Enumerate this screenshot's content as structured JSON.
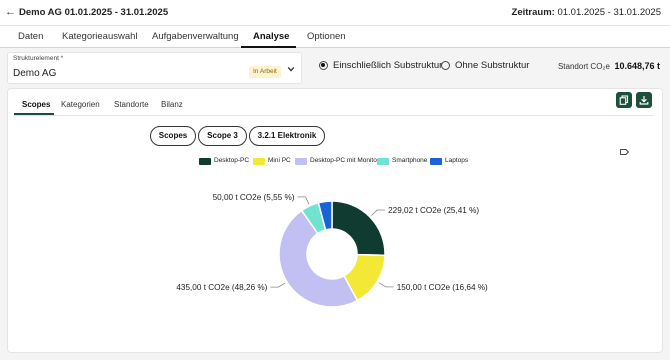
{
  "header": {
    "title": "Demo AG 01.01.2025 - 31.01.2025",
    "zeitraum_label": "Zeitraum:",
    "zeitraum_value": "01.01.2025 - 31.01.2025"
  },
  "tabs": [
    {
      "label": "Daten"
    },
    {
      "label": "Kategorieauswahl"
    },
    {
      "label": "Aufgabenverwaltung"
    },
    {
      "label": "Analyse",
      "active": true
    },
    {
      "label": "Optionen"
    }
  ],
  "structure": {
    "label": "Strukturelement *",
    "value": "Demo AG",
    "status": "In Arbeit"
  },
  "radio": {
    "with_label": "Einschließlich Substruktur",
    "without_label": "Ohne Substruktur",
    "selected": "with"
  },
  "standort": {
    "label": "Standort CO₂e",
    "value": "10.648,76 t"
  },
  "subtabs": [
    {
      "label": "Scopes",
      "active": true
    },
    {
      "label": "Kategorien"
    },
    {
      "label": "Standorte"
    },
    {
      "label": "Bilanz"
    }
  ],
  "actions": {
    "copy_icon": "copy-icon",
    "download_icon": "download-icon"
  },
  "breadcrumb_pills": [
    "Scopes",
    "Scope 3",
    "3.2.1 Elektronik"
  ],
  "chart_data": {
    "type": "pie",
    "donut": true,
    "legend_placement": "top",
    "categories": [
      "Desktop-PC",
      "Mini PC",
      "Desktop-PC mit Monitor",
      "Smartphone",
      "Laptops"
    ],
    "values": [
      229.02,
      150.0,
      435.0,
      50.0,
      37.24
    ],
    "percentages": [
      25.41,
      16.64,
      48.26,
      5.55,
      4.13
    ],
    "colors": [
      "#0f3b31",
      "#f2e835",
      "#c2bff2",
      "#6fe3cf",
      "#1a63d6"
    ],
    "data_labels": [
      "229,02 t  CO2e (25,41 %)",
      "150,00 t  CO2e (16,64 %)",
      "435,00 t  CO2e (48,26 %)",
      "50,00 t  CO2e (5,55 %)",
      ""
    ]
  }
}
